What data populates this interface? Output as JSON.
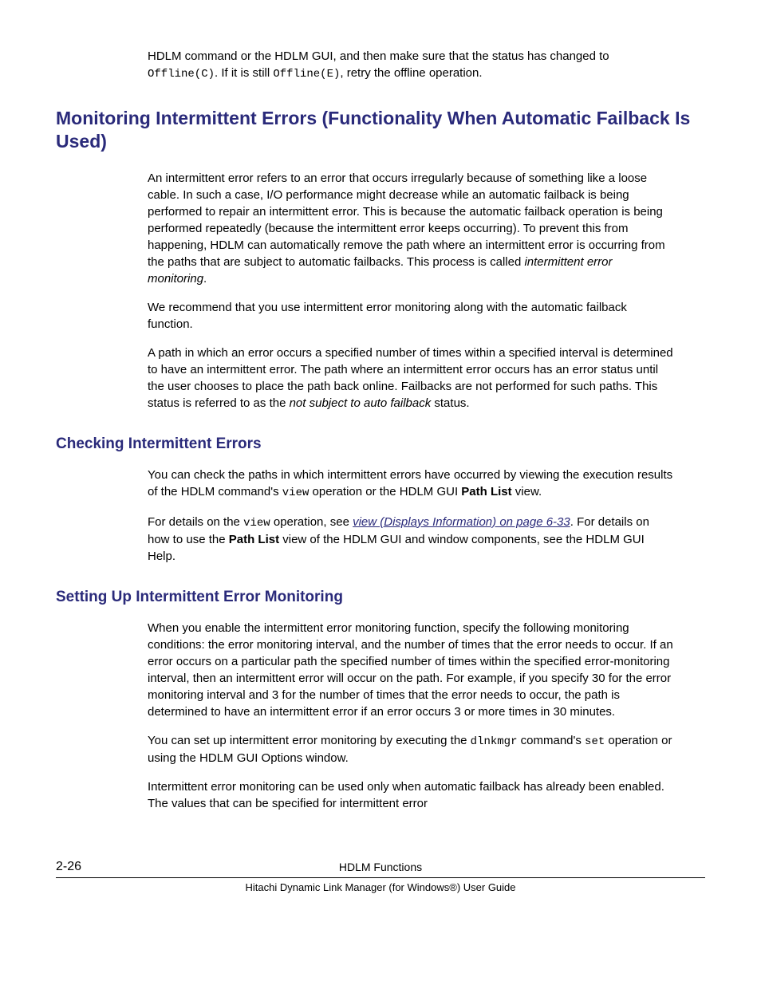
{
  "intro": {
    "p1_a": "HDLM command or the HDLM GUI, and then make sure that the status has changed to ",
    "p1_code1": "Offline(C)",
    "p1_b": ". If it is still ",
    "p1_code2": "Offline(E)",
    "p1_c": ", retry the offline operation."
  },
  "h1": "Monitoring Intermittent Errors (Functionality When Automatic Failback Is Used)",
  "sec1": {
    "p1_a": "An intermittent error refers to an error that occurs irregularly because of something like a loose cable. In such a case, I/O performance might decrease while an automatic failback is being performed to repair an intermittent error. This is because the automatic failback operation is being performed repeatedly (because the intermittent error keeps occurring). To prevent this from happening, HDLM can automatically remove the path where an intermittent error is occurring from the paths that are subject to automatic failbacks. This process is called ",
    "p1_em": "intermittent error monitoring",
    "p1_b": ".",
    "p2": "We recommend that you use intermittent error monitoring along with the automatic failback function.",
    "p3_a": "A path in which an error occurs a specified number of times within a specified interval is determined to have an intermittent error. The path where an intermittent error occurs has an error status until the user chooses to place the path back online. Failbacks are not performed for such paths. This status is referred to as the ",
    "p3_em": "not subject to auto failback",
    "p3_b": " status."
  },
  "h2a": "Checking Intermittent Errors",
  "sec2": {
    "p1_a": "You can check the paths in which intermittent errors have occurred by viewing the execution results of the HDLM command's ",
    "p1_code": "view",
    "p1_b": " operation or the HDLM GUI ",
    "p1_bold": "Path List",
    "p1_c": " view.",
    "p2_a": "For details on the ",
    "p2_code": "view",
    "p2_b": " operation, see ",
    "p2_link": "view (Displays Information) on page 6-33",
    "p2_c": ". For details on how to use the ",
    "p2_bold": "Path List",
    "p2_d": " view of the HDLM GUI and window components, see the HDLM GUI Help."
  },
  "h2b": "Setting Up Intermittent Error Monitoring",
  "sec3": {
    "p1": "When you enable the intermittent error monitoring function, specify the following monitoring conditions: the error monitoring interval, and the number of times that the error needs to occur. If an error occurs on a particular path the specified number of times within the specified error-monitoring interval, then an intermittent error will occur on the path. For example, if you specify 30 for the error monitoring interval and 3 for the number of times that the error needs to occur, the path is determined to have an intermittent error if an error occurs 3 or more times in 30 minutes.",
    "p2_a": "You can set up intermittent error monitoring by executing the ",
    "p2_code1": "dlnkmgr",
    "p2_b": " command's ",
    "p2_code2": "set",
    "p2_c": " operation or using the HDLM GUI Options window.",
    "p3": "Intermittent error monitoring can be used only when automatic failback has already been enabled. The values that can be specified for intermittent error"
  },
  "footer": {
    "page": "2-26",
    "title": "HDLM Functions",
    "subtitle": "Hitachi Dynamic Link Manager (for Windows®) User Guide"
  }
}
